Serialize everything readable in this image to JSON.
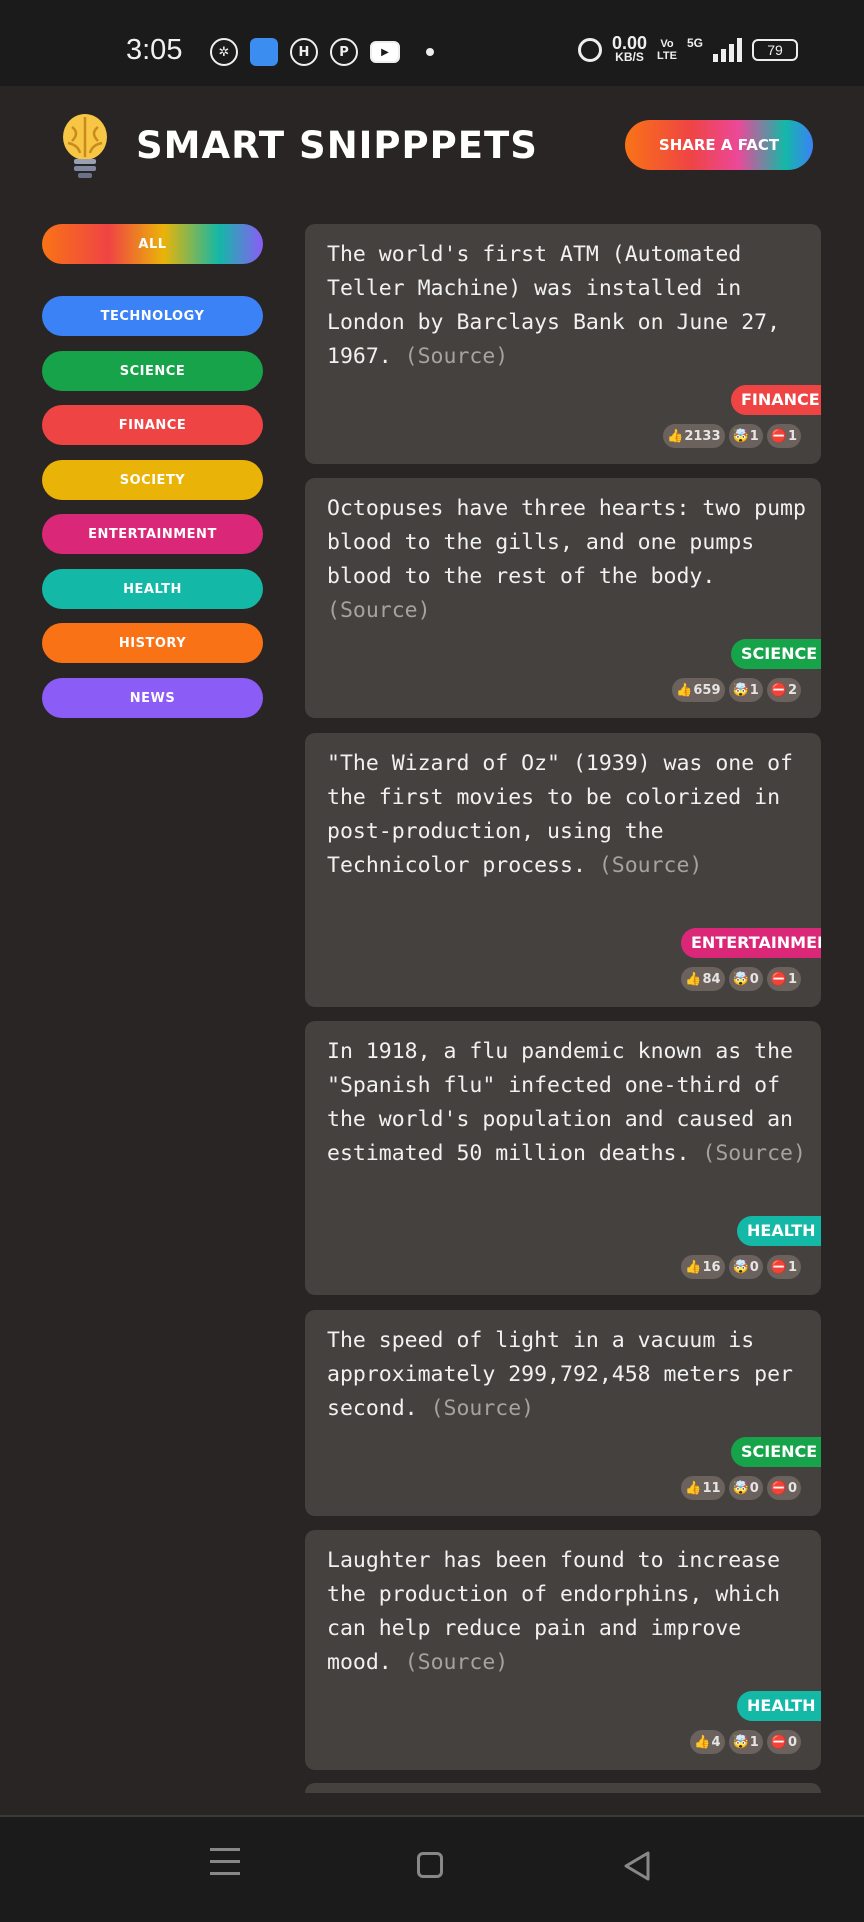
{
  "status_bar": {
    "time": "3:05",
    "net_speed": "0.00",
    "net_unit": "KB/S",
    "volte_top": "Vo",
    "volte_bottom": "LTE",
    "network": "5G",
    "battery": "79"
  },
  "header": {
    "title": "SMART SNIPPPETS",
    "share_label": "SHARE A FACT"
  },
  "categories": [
    {
      "label": "ALL",
      "color": "gradient"
    },
    {
      "label": "TECHNOLOGY",
      "color": "#3b82f6"
    },
    {
      "label": "SCIENCE",
      "color": "#16a34a"
    },
    {
      "label": "FINANCE",
      "color": "#ef4444"
    },
    {
      "label": "SOCIETY",
      "color": "#eab308"
    },
    {
      "label": "ENTERTAINMENT",
      "color": "#db2777"
    },
    {
      "label": "HEALTH",
      "color": "#14b8a6"
    },
    {
      "label": "HISTORY",
      "color": "#f97316"
    },
    {
      "label": "NEWS",
      "color": "#8b5cf6"
    }
  ],
  "facts": [
    {
      "text": "The world's first ATM (Automated Teller Machine) was installed in London by Barclays Bank on June 27, 1967. ",
      "source": "(Source)",
      "tag": "FINANCE",
      "tag_color": "#ef4444",
      "likes": "2133",
      "mindblown": "1",
      "dislikes": "1"
    },
    {
      "text": "Octopuses have three hearts: two pump blood to the gills, and one pumps blood to the rest of the body.",
      "source": "(Source)",
      "tag": "SCIENCE",
      "tag_color": "#16a34a",
      "likes": "659",
      "mindblown": "1",
      "dislikes": "2"
    },
    {
      "text": "\"The Wizard of Oz\" (1939) was one of the first movies to be colorized in post-production, using the Technicolor process. ",
      "source": "(Source)",
      "tag": "ENTERTAINMENT",
      "tag_color": "#db2777",
      "likes": "84",
      "mindblown": "0",
      "dislikes": "1"
    },
    {
      "text": "In 1918, a flu pandemic known as the \"Spanish flu\" infected one-third of the world's population and caused an estimated 50 million deaths. ",
      "source": "(Source)",
      "tag": "HEALTH",
      "tag_color": "#14b8a6",
      "likes": "16",
      "mindblown": "0",
      "dislikes": "1"
    },
    {
      "text": "The speed of light in a vacuum is approximately 299,792,458 meters per second.",
      "source": "(Source)",
      "tag": "SCIENCE",
      "tag_color": "#16a34a",
      "likes": "11",
      "mindblown": "0",
      "dislikes": "0"
    },
    {
      "text": "Laughter has been found to increase the production of endorphins, which can help reduce pain and improve mood.",
      "source": "(Source)",
      "tag": "HEALTH",
      "tag_color": "#14b8a6",
      "likes": "4",
      "mindblown": "1",
      "dislikes": "0"
    }
  ]
}
